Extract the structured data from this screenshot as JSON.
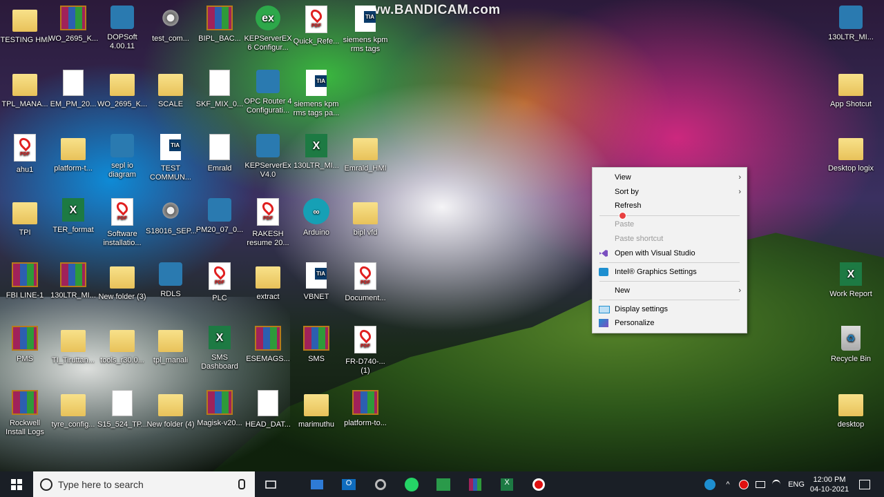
{
  "watermark": "www.BANDICAM.com",
  "desktop_icons": [
    {
      "label": "TESTING HMI",
      "type": "folder"
    },
    {
      "label": "WO_2695_K...",
      "type": "rar"
    },
    {
      "label": "DOPSoft 4.00.11",
      "type": "app"
    },
    {
      "label": "test_com...",
      "type": "gear"
    },
    {
      "label": "BIPL_BAC...",
      "type": "rar"
    },
    {
      "label": "KEPServerEX 6 Configur...",
      "type": "green"
    },
    {
      "label": "Quick_Refe...",
      "type": "pdf"
    },
    {
      "label": "siemens kpm rms tags",
      "type": "tia"
    },
    {
      "label": "TPL_MANA...",
      "type": "folder"
    },
    {
      "label": "EM_PM_20...",
      "type": "doc"
    },
    {
      "label": "WO_2695_K...",
      "type": "folder"
    },
    {
      "label": "SCALE",
      "type": "folder"
    },
    {
      "label": "SKF_MIX_0...",
      "type": "doc"
    },
    {
      "label": "OPC Router 4 Configurati...",
      "type": "app"
    },
    {
      "label": "siemens kpm rms tags pa...",
      "type": "tia"
    },
    {
      "label": "ahu1",
      "type": "pdf"
    },
    {
      "label": "platform-t...",
      "type": "folder"
    },
    {
      "label": "sepl io diagram",
      "type": "app"
    },
    {
      "label": "TEST COMMUN...",
      "type": "tia"
    },
    {
      "label": "Emrald",
      "type": "doc"
    },
    {
      "label": "KEPServerEx V4.0",
      "type": "app"
    },
    {
      "label": "130LTR_MI...",
      "type": "excel"
    },
    {
      "label": "Emrald_HMI",
      "type": "folder"
    },
    {
      "label": "TPI",
      "type": "folder"
    },
    {
      "label": "TER_format",
      "type": "excel"
    },
    {
      "label": "Software installatio...",
      "type": "pdf"
    },
    {
      "label": "S18016_SEP...",
      "type": "gear"
    },
    {
      "label": "PM20_07_0...",
      "type": "app"
    },
    {
      "label": "RAKESH resume 20...",
      "type": "pdf"
    },
    {
      "label": "Arduino",
      "type": "arduino"
    },
    {
      "label": "bipl vfd",
      "type": "folder"
    },
    {
      "label": "FBI LINE-1",
      "type": "rar"
    },
    {
      "label": "130LTR_MI...",
      "type": "rar"
    },
    {
      "label": "New folder (3)",
      "type": "folder"
    },
    {
      "label": "RDLS",
      "type": "app"
    },
    {
      "label": "PLC",
      "type": "pdf"
    },
    {
      "label": "extract",
      "type": "folder"
    },
    {
      "label": "VBNET",
      "type": "tia"
    },
    {
      "label": "Document...",
      "type": "pdf"
    },
    {
      "label": "PMS",
      "type": "rar"
    },
    {
      "label": "TI_Tiruttan...",
      "type": "folder"
    },
    {
      "label": "tools_r30.0...",
      "type": "folder"
    },
    {
      "label": "tpl_manali",
      "type": "folder"
    },
    {
      "label": "SMS Dashboard",
      "type": "excel"
    },
    {
      "label": "ESEMAGS...",
      "type": "rar"
    },
    {
      "label": "SMS",
      "type": "rar"
    },
    {
      "label": "FR-D740-... (1)",
      "type": "pdf"
    },
    {
      "label": "Rockwell Install Logs",
      "type": "rar"
    },
    {
      "label": "tyre_config...",
      "type": "folder"
    },
    {
      "label": "S15_524_TP...",
      "type": "doc"
    },
    {
      "label": "New folder (4)",
      "type": "folder"
    },
    {
      "label": "Magisk-v20...",
      "type": "rar"
    },
    {
      "label": "HEAD_DAT...",
      "type": "doc"
    },
    {
      "label": "marimuthu",
      "type": "folder"
    },
    {
      "label": "platform-to...",
      "type": "rar"
    }
  ],
  "right_icons": [
    {
      "label": "130LTR_MI...",
      "type": "app"
    },
    {
      "label": "App Shotcut",
      "type": "folder"
    },
    {
      "label": "Desktop logix",
      "type": "folder"
    },
    {
      "label": "Work Report",
      "type": "excel"
    },
    {
      "label": "Recycle Bin",
      "type": "recycle"
    },
    {
      "label": "desktop",
      "type": "folder"
    }
  ],
  "context_menu": {
    "view": "View",
    "sort_by": "Sort by",
    "refresh": "Refresh",
    "paste": "Paste",
    "paste_shortcut": "Paste shortcut",
    "open_vs": "Open with Visual Studio",
    "intel": "Intel® Graphics Settings",
    "new": "New",
    "display_settings": "Display settings",
    "personalize": "Personalize"
  },
  "taskbar": {
    "search_placeholder": "Type here to search",
    "language": "ENG",
    "time": "12:00 PM",
    "date": "04-10-2021"
  },
  "colors": {
    "taskbar": "#1a1f26",
    "menu_bg": "#f2f2f2",
    "vs_purple": "#7b4fc0",
    "intel_blue": "#1e8fd0"
  }
}
